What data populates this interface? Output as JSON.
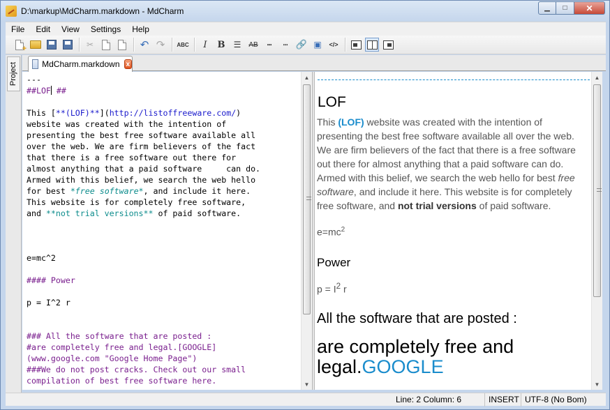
{
  "window": {
    "title": "D:\\markup\\MdCharm.markdown - MdCharm",
    "min": "▁",
    "max": "□",
    "close": "✕"
  },
  "menu": [
    "File",
    "Edit",
    "View",
    "Settings",
    "Help"
  ],
  "toolbar": {
    "spell_label": "ABC",
    "italic": "I",
    "bold": "B",
    "strike": "AB",
    "code": "</>"
  },
  "side_panel": {
    "tab": "Project"
  },
  "tabs": [
    {
      "label": "MdCharm.markdown",
      "close": "x"
    }
  ],
  "editor": {
    "lines": {
      "l1": "---",
      "l2a": "##LOF",
      "l2b": " ##",
      "l4a": "This [",
      "l4b": "**(LOF)**",
      "l4c": "](",
      "l4d": "http://listoffreeware.com/",
      "l4e": ")",
      "l5": "website was created with the intention of",
      "l6": "presenting the best free software available all",
      "l7": "over the web. We are firm believers of the fact",
      "l8": "that there is a free software out there for",
      "l9": "almost anything that a paid software     can do.",
      "l10": "Armed with this belief, we search the web hello",
      "l11a": "for best ",
      "l11b": "*free software*",
      "l11c": ", and include it here.",
      "l12": "This website is for completely free software,",
      "l13a": "and ",
      "l13b": "**not trial versions**",
      "l13c": " of paid software.",
      "l17": "e=mc^2",
      "l19": "#### Power",
      "l21": "p = I^2 r",
      "l24": "### All the software that are posted :",
      "l25": "#are completely free and legal.[GOOGLE]",
      "l26": "(www.google.com \"Google Home Page\")",
      "l27": "###We do not post cracks. Check out our small",
      "l28": "compilation of best free software here."
    }
  },
  "preview": {
    "h2": "LOF",
    "p1_a": "This ",
    "p1_link": "(LOF)",
    "p1_b": " website was created with the intention of presenting the best free software available all over the web. We are firm believers of the fact that there is a free software out there for almost anything that a paid software can do. Armed with this belief, we search the web hello for best ",
    "p1_em": "free software",
    "p1_c": ", and include it here. This website is for completely free software, and ",
    "p1_strong": "not trial versions",
    "p1_d": " of paid software.",
    "eq1": "e=mc",
    "eq1_sup": "2",
    "h4": "Power",
    "eq2_a": "p = I",
    "eq2_sup": "2",
    "eq2_b": " r",
    "h3": "All the software that are posted :",
    "h1_a": "are completely free and legal.",
    "h1_link": "GOOGLE"
  },
  "status": {
    "position": "Line: 2 Column: 6",
    "mode": "INSERT",
    "encoding": "UTF-8 (No Bom)"
  }
}
